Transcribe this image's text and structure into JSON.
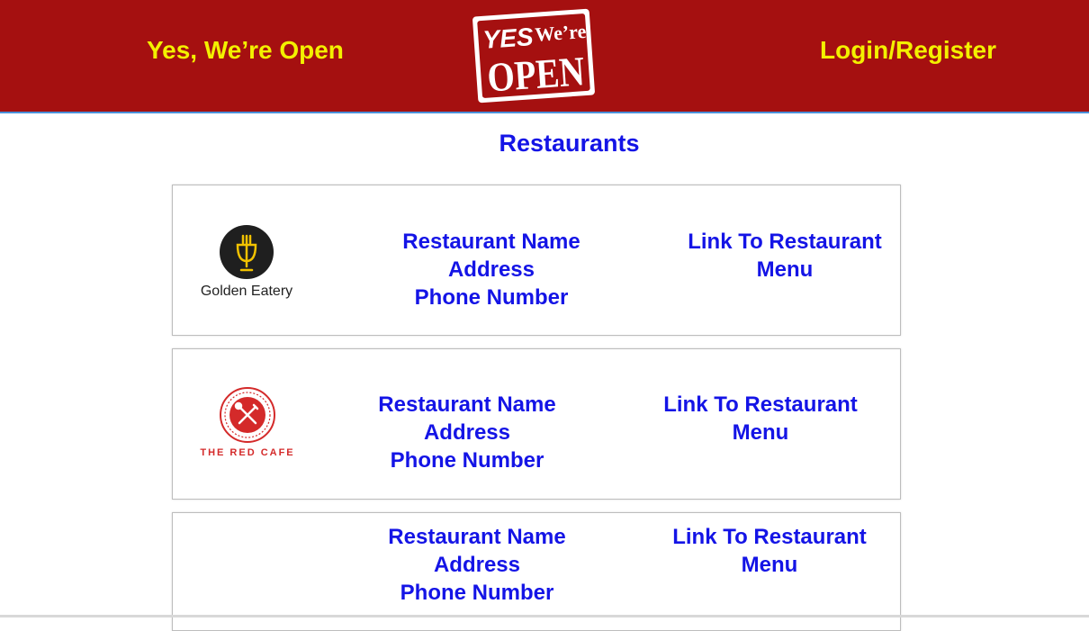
{
  "header": {
    "left_text": "Yes, We’re Open",
    "right_link": "Login/Register",
    "logo_text_yes": "YES",
    "logo_text_were": "We’re",
    "logo_text_open": "OPEN",
    "colors": {
      "bar": "#a51010",
      "accent_text": "#f3f000"
    }
  },
  "main": {
    "title": "Restaurants",
    "title_color": "#1414e6",
    "restaurants": [
      {
        "logo_text": "Golden Eatery",
        "logo_icon": "fork-wineglass-icon",
        "name": "Restaurant Name",
        "address": "Address",
        "phone": "Phone Number",
        "menu_link": "Link To Restaurant Menu"
      },
      {
        "logo_text": "THE RED CAFE",
        "logo_icon": "spoon-fork-cross-icon",
        "name": "Restaurant Name",
        "address": "Address",
        "phone": "Phone Number",
        "menu_link": "Link To Restaurant Menu"
      },
      {
        "logo_text": "",
        "name": "Restaurant Name",
        "address": "Address",
        "phone": "Phone Number",
        "menu_link": "Link To Restaurant Menu"
      }
    ]
  }
}
